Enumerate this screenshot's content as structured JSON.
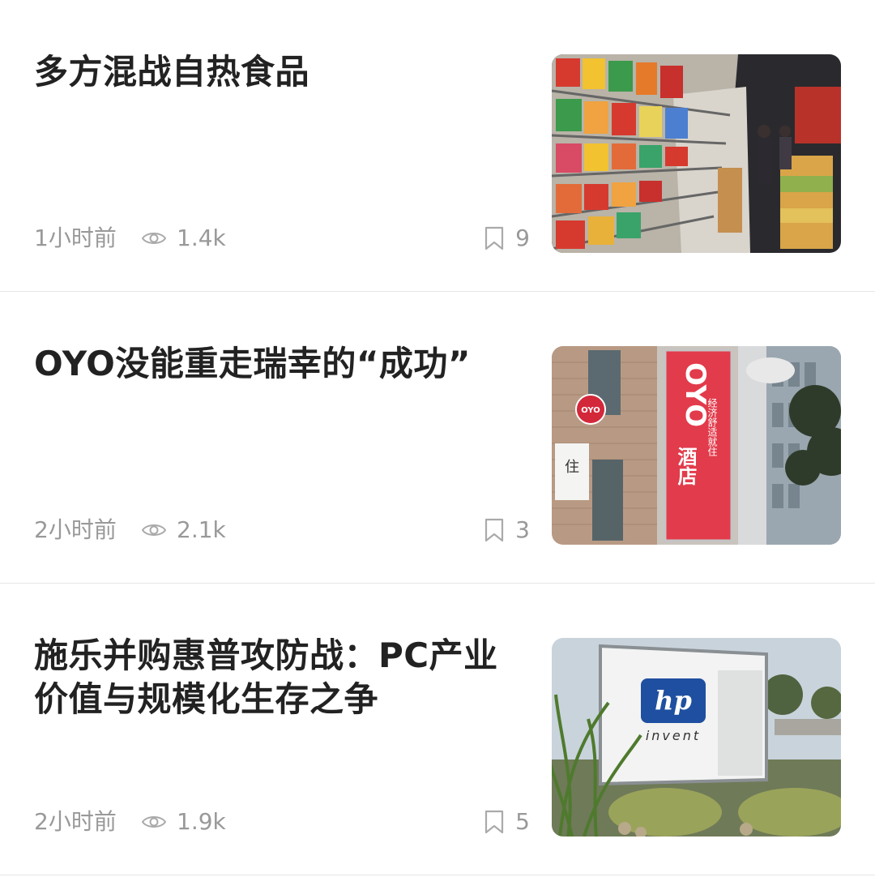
{
  "articles": [
    {
      "title": "多方混战自热食品",
      "time": "1小时前",
      "views": "1.4k",
      "bookmarks": "9",
      "image": "supermarket-aisle-photo"
    },
    {
      "title": "OYO没能重走瑞幸的“成功”",
      "time": "2小时前",
      "views": "2.1k",
      "bookmarks": "3",
      "image": "oyo-hotel-sign-photo",
      "image_text": {
        "brand": "OYO",
        "sign_main": "酒店",
        "sign_tagline": "经济舒适就住",
        "small_sign": "OYO"
      }
    },
    {
      "title": "施乐并购惠普攻防战：PC产业价值与规模化生存之争",
      "time": "2小时前",
      "views": "1.9k",
      "bookmarks": "5",
      "image": "hp-invent-sign-photo",
      "image_text": {
        "logo": "hp",
        "slogan": "invent"
      }
    }
  ],
  "icons": {
    "views": "eye-icon",
    "bookmark": "bookmark-icon"
  },
  "colors": {
    "title": "#222222",
    "meta": "#999999",
    "divider": "#e6e6e6",
    "oyo_red": "#e23b4b",
    "hp_blue": "#1f4fa0"
  }
}
